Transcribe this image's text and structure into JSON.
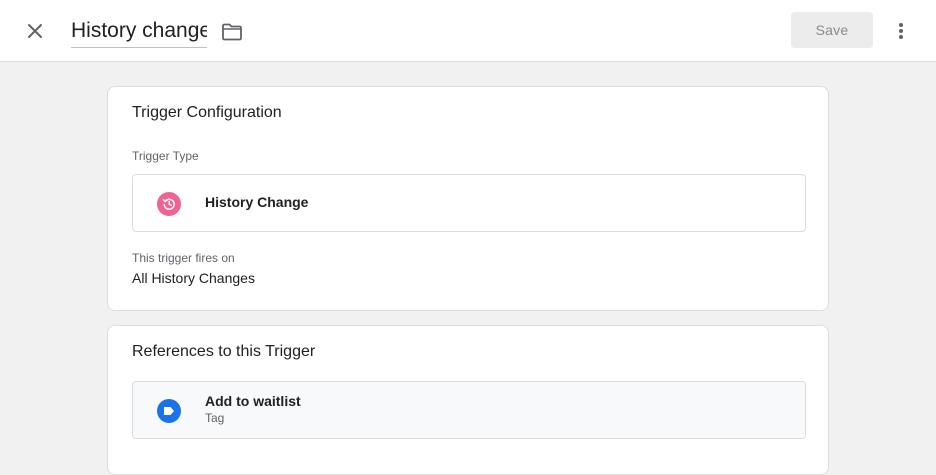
{
  "header": {
    "close_icon": "close-icon",
    "title": "History change",
    "folder_icon": "folder-icon",
    "save_label": "Save",
    "more_icon": "more-vert-icon"
  },
  "trigger_configuration": {
    "title": "Trigger Configuration",
    "type_label": "Trigger Type",
    "type_icon": "history-icon",
    "type_icon_color": "#f06292",
    "type_name": "History Change",
    "fires_label": "This trigger fires on",
    "fires_value": "All History Changes"
  },
  "references": {
    "title": "References to this Trigger",
    "items": [
      {
        "icon": "tag-icon",
        "icon_color": "#1a73e8",
        "name": "Add to waitlist",
        "kind": "Tag"
      }
    ]
  }
}
